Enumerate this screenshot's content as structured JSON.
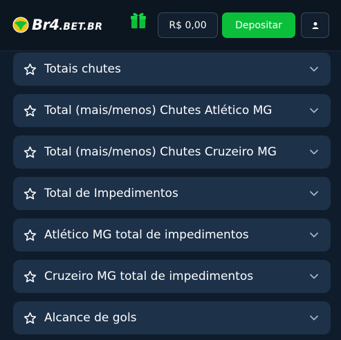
{
  "header": {
    "logo": {
      "brand": "Br4",
      "domain": ".BET.BR"
    },
    "balance": "R$ 0,00",
    "deposit_label": "Depositar"
  },
  "colors": {
    "background": "#0f1c2b",
    "header_bg": "#0c1621",
    "row_bg": "#1d3149",
    "accent_green": "#0bbf3a"
  },
  "markets": [
    {
      "label": "Totais chutes",
      "icon": "star-icon"
    },
    {
      "label": "Total (mais/menos) Chutes Atlético MG",
      "icon": "star-icon"
    },
    {
      "label": "Total (mais/menos) Chutes Cruzeiro MG",
      "icon": "star-icon"
    },
    {
      "label": "Total de Impedimentos",
      "icon": "star-icon"
    },
    {
      "label": "Atlético MG total de impedimentos",
      "icon": "star-icon"
    },
    {
      "label": "Cruzeiro MG total de impedimentos",
      "icon": "star-icon"
    },
    {
      "label": "Alcance de gols",
      "icon": "star-icon"
    }
  ]
}
